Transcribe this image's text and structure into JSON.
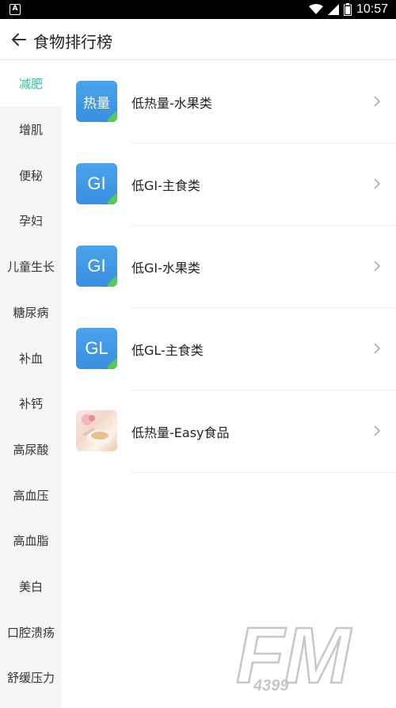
{
  "status_bar": {
    "time": "10:57",
    "left_icon": "A",
    "icons": [
      "wifi-icon",
      "signal-icon",
      "battery-icon"
    ]
  },
  "header": {
    "title": "食物排行榜",
    "back_icon": "arrow-left-icon"
  },
  "sidebar": {
    "active_index": 0,
    "items": [
      {
        "label": "减肥"
      },
      {
        "label": "增肌"
      },
      {
        "label": "便秘"
      },
      {
        "label": "孕妇"
      },
      {
        "label": "儿童生长"
      },
      {
        "label": "糖尿病"
      },
      {
        "label": "补血"
      },
      {
        "label": "补钙"
      },
      {
        "label": "高尿酸"
      },
      {
        "label": "高血压"
      },
      {
        "label": "高血脂"
      },
      {
        "label": "美白"
      },
      {
        "label": "口腔溃疡"
      },
      {
        "label": "舒缓压力"
      }
    ]
  },
  "list": {
    "items": [
      {
        "icon_text": "热量",
        "label": "低热量-水果类"
      },
      {
        "icon_text": "GI",
        "label": "低GI-主食类"
      },
      {
        "icon_text": "GI",
        "label": "低GI-水果类"
      },
      {
        "icon_text": "GL",
        "label": "低GL-主食类"
      },
      {
        "icon_text": "",
        "label": "低热量-Easy食品"
      }
    ]
  },
  "watermark": {
    "brand": "FM",
    "sub": "4399"
  },
  "colors": {
    "accent": "#2ec4a6",
    "icon_blue": "#4aa3ec",
    "icon_green": "#58c85a",
    "sidebar_bg": "#f5f5f5"
  }
}
